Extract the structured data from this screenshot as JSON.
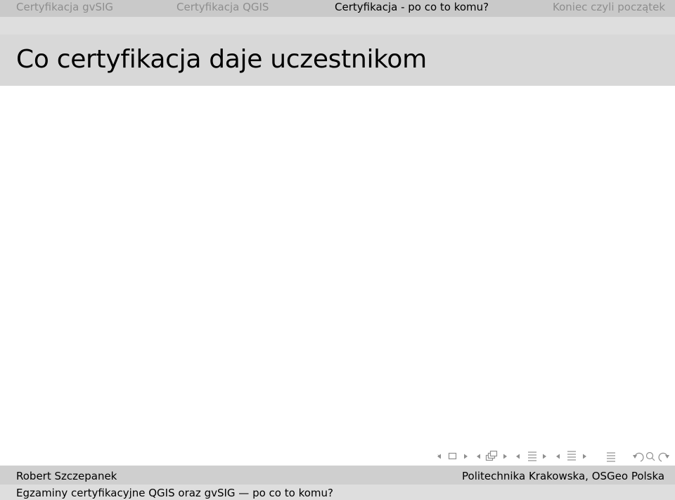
{
  "navigation": {
    "sections": [
      {
        "label": "Certyfikacja gvSIG",
        "active": false
      },
      {
        "label": "Certyfikacja QGIS",
        "active": false
      },
      {
        "label": "Certyfikacja - po co to komu?",
        "active": true
      },
      {
        "label": "Koniec czyli początek",
        "active": false
      }
    ]
  },
  "frame": {
    "title": "Co certyfikacja daje uczestnikom"
  },
  "nav_controls": {
    "icons": [
      "slide-prev-icon",
      "slide-icon",
      "slide-next-icon",
      "frame-prev-icon",
      "frame-icon",
      "frame-next-icon",
      "subsection-prev-icon",
      "subsection-icon",
      "subsection-next-icon",
      "section-prev-icon",
      "section-icon",
      "section-next-icon",
      "toc-icon",
      "back-icon",
      "search-icon",
      "forward-icon"
    ]
  },
  "footer": {
    "author": "Robert Szczepanek",
    "institute": "Politechnika Krakowska,  OSGeo Polska",
    "title": "Egzaminy certyfikacyjne QGIS oraz gvSIG —  po co to komu?"
  },
  "colors": {
    "nav_bar": "#c9c9c9",
    "nav_sub": "#dedede",
    "title_bar": "#d8d8d8",
    "inactive_text": "#8e8e8e",
    "footer_top": "#cfcfcf",
    "footer_bottom": "#dedede",
    "control_gray": "#8f8f8f"
  }
}
